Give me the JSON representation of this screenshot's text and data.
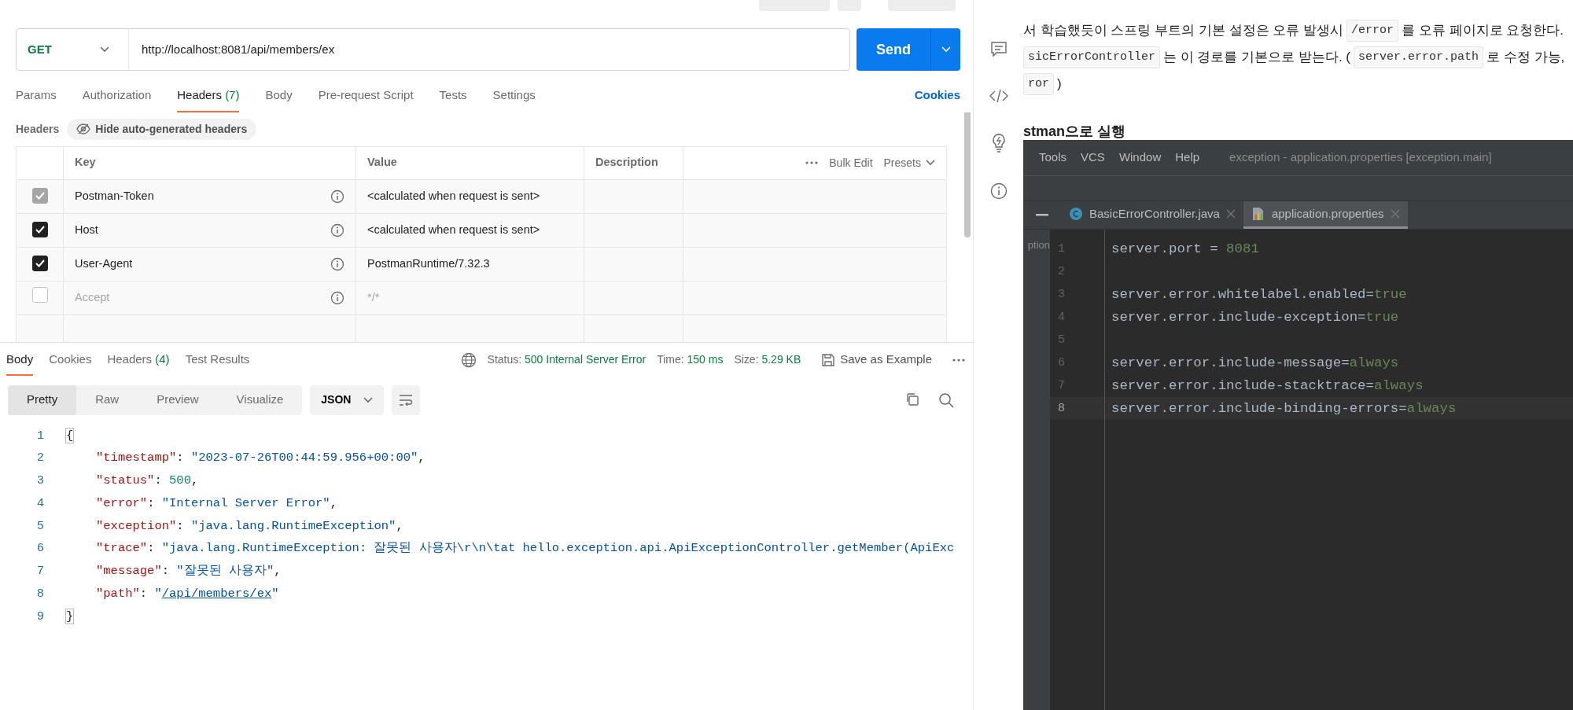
{
  "request": {
    "method": "GET",
    "url": "http://localhost:8081/api/members/ex",
    "send_label": "Send"
  },
  "request_tabs": [
    {
      "label": "Params",
      "selected": false
    },
    {
      "label": "Authorization",
      "selected": false
    },
    {
      "label": "Headers",
      "count": "(7)",
      "selected": true
    },
    {
      "label": "Body",
      "selected": false
    },
    {
      "label": "Pre-request Script",
      "selected": false
    },
    {
      "label": "Tests",
      "selected": false
    },
    {
      "label": "Settings",
      "selected": false
    }
  ],
  "cookies_link": "Cookies",
  "headers_section": {
    "title": "Headers",
    "toggle": "Hide auto-generated headers"
  },
  "headers_table": {
    "columns": [
      "Key",
      "Value",
      "Description"
    ],
    "bulk_edit": "Bulk Edit",
    "presets": "Presets",
    "rows": [
      {
        "key": "Postman-Token",
        "value": "<calculated when request is sent>",
        "checked": true,
        "locked": true
      },
      {
        "key": "Host",
        "value": "<calculated when request is sent>",
        "checked": true,
        "locked": false
      },
      {
        "key": "User-Agent",
        "value": "PostmanRuntime/7.32.3",
        "checked": true,
        "locked": false
      },
      {
        "key": "Accept",
        "value": "*/*",
        "checked": false,
        "locked": false
      }
    ]
  },
  "response_tabs": [
    {
      "label": "Body",
      "selected": true
    },
    {
      "label": "Cookies",
      "selected": false
    },
    {
      "label": "Headers",
      "count": "(4)",
      "selected": false
    },
    {
      "label": "Test Results",
      "selected": false
    }
  ],
  "response_meta": [
    {
      "label": "Status:",
      "value": "500 Internal Server Error"
    },
    {
      "label": "Time:",
      "value": "150 ms"
    },
    {
      "label": "Size:",
      "value": "5.29 KB"
    }
  ],
  "save_example": "Save as Example",
  "format_tabs": [
    {
      "label": "Pretty",
      "selected": true
    },
    {
      "label": "Raw",
      "selected": false
    },
    {
      "label": "Preview",
      "selected": false
    },
    {
      "label": "Visualize",
      "selected": false
    }
  ],
  "format_select": "JSON",
  "response_body": [
    {
      "number": "1",
      "tokens": [
        {
          "kind": "bracket",
          "text": "{"
        }
      ],
      "children": [
        {
          "number": "2",
          "tokens": [
            {
              "kind": "key",
              "text": "\"timestamp\""
            },
            {
              "kind": "punct",
              "text": ": "
            },
            {
              "kind": "string",
              "text": "\"2023-07-26T00:44:59.956+00:00\""
            },
            {
              "kind": "punct",
              "text": ","
            }
          ]
        },
        {
          "number": "3",
          "tokens": [
            {
              "kind": "key",
              "text": "\"status\""
            },
            {
              "kind": "punct",
              "text": ": "
            },
            {
              "kind": "number",
              "text": "500"
            },
            {
              "kind": "punct",
              "text": ","
            }
          ]
        },
        {
          "number": "4",
          "tokens": [
            {
              "kind": "key",
              "text": "\"error\""
            },
            {
              "kind": "punct",
              "text": ": "
            },
            {
              "kind": "string",
              "text": "\"Internal Server Error\""
            },
            {
              "kind": "punct",
              "text": ","
            }
          ]
        },
        {
          "number": "5",
          "tokens": [
            {
              "kind": "key",
              "text": "\"exception\""
            },
            {
              "kind": "punct",
              "text": ": "
            },
            {
              "kind": "string",
              "text": "\"java.lang.RuntimeException\""
            },
            {
              "kind": "punct",
              "text": ","
            }
          ]
        },
        {
          "number": "6",
          "tokens": [
            {
              "kind": "key",
              "text": "\"trace\""
            },
            {
              "kind": "punct",
              "text": ": "
            },
            {
              "kind": "string",
              "text": "\"java.lang.RuntimeException: 잘못된 사용자\\r\\n\\tat hello.exception.api.ApiExceptionController.getMember(ApiExc"
            }
          ]
        },
        {
          "number": "7",
          "tokens": [
            {
              "kind": "key",
              "text": "\"message\""
            },
            {
              "kind": "punct",
              "text": ": "
            },
            {
              "kind": "string",
              "text": "\"잘못된 사용자\""
            },
            {
              "kind": "punct",
              "text": ","
            }
          ]
        },
        {
          "number": "8",
          "tokens": [
            {
              "kind": "key",
              "text": "\"path\""
            },
            {
              "kind": "punct",
              "text": ": "
            },
            {
              "kind": "string",
              "text": "\""
            },
            {
              "kind": "link",
              "text": "/api/members/ex"
            },
            {
              "kind": "string",
              "text": "\""
            }
          ]
        }
      ]
    },
    {
      "number": "9",
      "tokens": [
        {
          "kind": "bracket",
          "text": "}"
        }
      ]
    }
  ],
  "document": [
    {
      "kind": "text",
      "segments": [
        {
          "kind": "text",
          "text": "서 학습했듯이 스프링 부트의 기본 설정은 오류 발생시"
        },
        {
          "kind": "code",
          "text": "/error"
        },
        {
          "kind": "text",
          "text": "를 오류 페이지로 요청한다."
        }
      ]
    },
    {
      "kind": "text",
      "segments": [
        {
          "kind": "code",
          "text": "sicErrorController"
        },
        {
          "kind": "text",
          "text": "는 이 경로를 기본으로 받는다. ("
        },
        {
          "kind": "code",
          "text": "server.error.path"
        },
        {
          "kind": "text",
          "text": "로 수정 가능,"
        }
      ]
    },
    {
      "kind": "text",
      "segments": [
        {
          "kind": "code",
          "text": "ror"
        },
        {
          "kind": "text",
          "text": ")"
        }
      ]
    },
    {
      "kind": "heading",
      "segments": [
        {
          "kind": "text",
          "text": "stman으로 실행"
        }
      ]
    }
  ],
  "ide": {
    "menu": [
      "Tools",
      "VCS",
      "Window",
      "Help"
    ],
    "title": "exception - application.properties [exception.main]",
    "tabs": [
      {
        "label": "BasicErrorController.java",
        "kind": "java",
        "selected": false
      },
      {
        "label": "application.properties",
        "kind": "properties",
        "selected": true
      }
    ],
    "project_label": "ption",
    "lines": [
      {
        "number": "1",
        "key": "server.port = ",
        "value": "8081",
        "current": false
      },
      {
        "number": "2",
        "current": false
      },
      {
        "number": "3",
        "key": "server.error.whitelabel.enabled=",
        "value": "true",
        "current": false
      },
      {
        "number": "4",
        "key": "server.error.include-exception=",
        "value": "true",
        "current": false
      },
      {
        "number": "5",
        "current": false
      },
      {
        "number": "6",
        "key": "server.error.include-message=",
        "value": "always",
        "current": false
      },
      {
        "number": "7",
        "key": "server.error.include-stacktrace=",
        "value": "always",
        "current": false
      },
      {
        "number": "8",
        "key": "server.error.include-binding-errors=",
        "value": "always",
        "current": true
      }
    ]
  }
}
